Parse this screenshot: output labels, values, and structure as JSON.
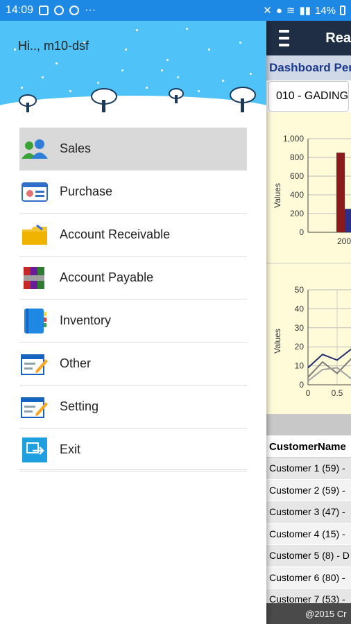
{
  "status_bar": {
    "time": "14:09",
    "battery": "14%"
  },
  "drawer": {
    "greeting": "Hi.., m10-dsf",
    "menu": [
      {
        "label": "Sales",
        "icon": "users-icon",
        "active": true
      },
      {
        "label": "Purchase",
        "icon": "id-card-icon",
        "active": false
      },
      {
        "label": "Account Receivable",
        "icon": "folder-icon",
        "active": false
      },
      {
        "label": "Account Payable",
        "icon": "archive-icon",
        "active": false
      },
      {
        "label": "Inventory",
        "icon": "notebook-icon",
        "active": false
      },
      {
        "label": "Other",
        "icon": "edit-form-icon",
        "active": false
      },
      {
        "label": "Setting",
        "icon": "edit-form-icon",
        "active": false
      },
      {
        "label": "Exit",
        "icon": "exit-icon",
        "active": false
      }
    ]
  },
  "app": {
    "title": "Rea",
    "dashboard_title": "Dashboard Per",
    "branch_value": "010 - GADING",
    "chart1": {
      "ylabel": "Values",
      "y_ticks": [
        "1,000",
        "800",
        "600",
        "400",
        "200",
        "0"
      ],
      "x_tick": "200"
    },
    "chart2": {
      "ylabel": "Values",
      "y_ticks": [
        "50",
        "40",
        "30",
        "20",
        "10",
        "0"
      ],
      "x_ticks": [
        "0",
        "0.5"
      ]
    },
    "table_header": "CustomerName",
    "customers": [
      "Customer 1  (59) -",
      "Customer 2  (59) -",
      "Customer 3  (47) -",
      "Customer 4  (15) -",
      "Customer 5  (8) - D",
      "Customer 6  (80) -",
      "Customer 7  (53) -"
    ],
    "footer": "@2015 Cr"
  },
  "chart_data": [
    {
      "type": "bar",
      "ylabel": "Values",
      "ylim": [
        0,
        1000
      ],
      "categories": [
        "200"
      ],
      "series": [
        {
          "values": [
            850
          ],
          "color": "#8b1a1a"
        },
        {
          "values": [
            250
          ],
          "color": "#2b2f8a"
        }
      ]
    },
    {
      "type": "line",
      "ylabel": "Values",
      "ylim": [
        0,
        50
      ],
      "x": [
        0,
        0.25,
        0.5,
        0.75
      ],
      "series": [
        {
          "values": [
            9,
            16,
            13,
            19
          ],
          "color": "#1f2d70"
        },
        {
          "values": [
            4,
            12,
            6,
            14
          ],
          "color": "#7a7a7a"
        },
        {
          "values": [
            2,
            8,
            9,
            3
          ],
          "color": "#a0a0a0"
        }
      ]
    }
  ]
}
